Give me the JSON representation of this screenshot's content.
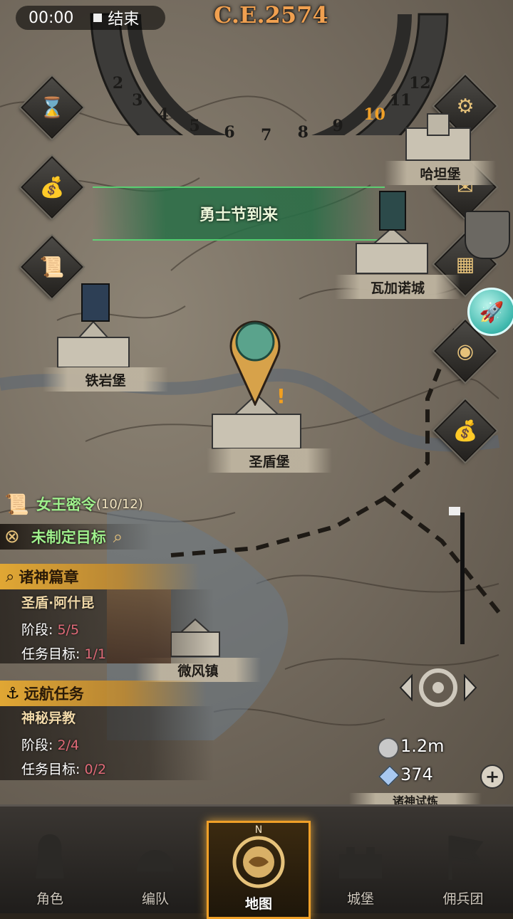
{
  "status_bar": {
    "time": "00:00",
    "stop_label": "结束"
  },
  "calendar": {
    "era": "C.E.2574",
    "numbers": [
      "2",
      "3",
      "4",
      "5",
      "6",
      "7",
      "8",
      "9",
      "10",
      "11",
      "12"
    ],
    "current": "10"
  },
  "event_banner": "勇士节到来",
  "locations": [
    {
      "name": "哈坦堡"
    },
    {
      "name": "瓦加诺城"
    },
    {
      "name": "铁岩堡"
    },
    {
      "name": "圣盾堡"
    },
    {
      "name": "微风镇"
    },
    {
      "name": "诸神试炼"
    }
  ],
  "quests": {
    "queen_order": {
      "label": "女王密令",
      "progress": "(10/12)"
    },
    "no_target": {
      "label": "未制定目标"
    },
    "gods_chapter": {
      "header": "诸神篇章",
      "name": "圣盾·阿什昆",
      "stage_label": "阶段:",
      "stage_value": "5/5",
      "goal_label": "任务目标:",
      "goal_value": "1/1"
    },
    "voyage": {
      "header": "远航任务",
      "name": "神秘异教",
      "stage_label": "阶段:",
      "stage_value": "2/4",
      "goal_label": "任务目标:",
      "goal_value": "0/2"
    }
  },
  "resources": {
    "silver": "1.2m",
    "crystal": "374"
  },
  "nav": [
    {
      "label": "角色",
      "active": false
    },
    {
      "label": "编队",
      "active": false
    },
    {
      "label": "地图",
      "active": true
    },
    {
      "label": "城堡",
      "active": false
    },
    {
      "label": "佣兵团",
      "active": false
    }
  ],
  "compass_letter": "N",
  "icons": [
    "hourglass-icon",
    "money-bag-icon",
    "scroll-icon",
    "gear-icon",
    "mail-icon",
    "shield-icon",
    "city-gate-icon",
    "rocket-icon",
    "coin-icon",
    "treasure-bag-icon"
  ],
  "colors": {
    "accent": "#f0a028",
    "quest_green": "#9ff08c",
    "value_red": "#e06a78"
  }
}
